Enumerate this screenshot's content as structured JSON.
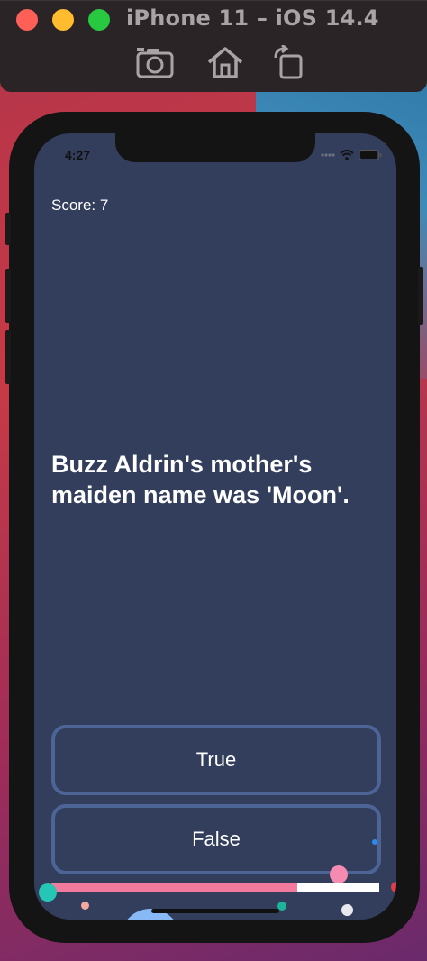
{
  "simulator": {
    "title": "iPhone 11 – iOS 14.4",
    "toolbar_buttons": [
      "screenshot-icon",
      "home-icon",
      "rotate-icon"
    ]
  },
  "status_bar": {
    "time": "4:27"
  },
  "quiz": {
    "score_label": "Score: 7",
    "question": "Buzz Aldrin's mother's maiden name was 'Moon'.",
    "true_label": "True",
    "false_label": "False",
    "progress": 0.75
  },
  "colors": {
    "screen_background": "#323e5c",
    "button_border": "#4c6596",
    "progress_fill": "#f27a9c",
    "progress_track": "#ffffff"
  }
}
